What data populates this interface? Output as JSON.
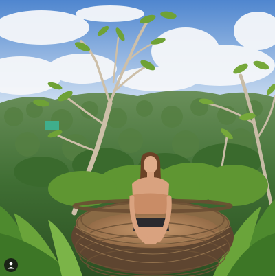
{
  "image": {
    "subject": "woman-sitting-in-woven-nest",
    "colors": {
      "sky_top": "#5b8fd3",
      "sky_bottom": "#d7e6f4",
      "cloud": "#f6f8fb",
      "jungle_far": "#4f7d3c",
      "jungle_near": "#2f5a26",
      "leaf_light": "#7fae3f",
      "nest": "#8a6a45",
      "nest_dark": "#5e4530",
      "skin": "#d9a27f",
      "top": "#c98c66",
      "hair": "#6b4226"
    }
  },
  "overlay": {
    "profile_icon": "user-avatar-icon"
  }
}
